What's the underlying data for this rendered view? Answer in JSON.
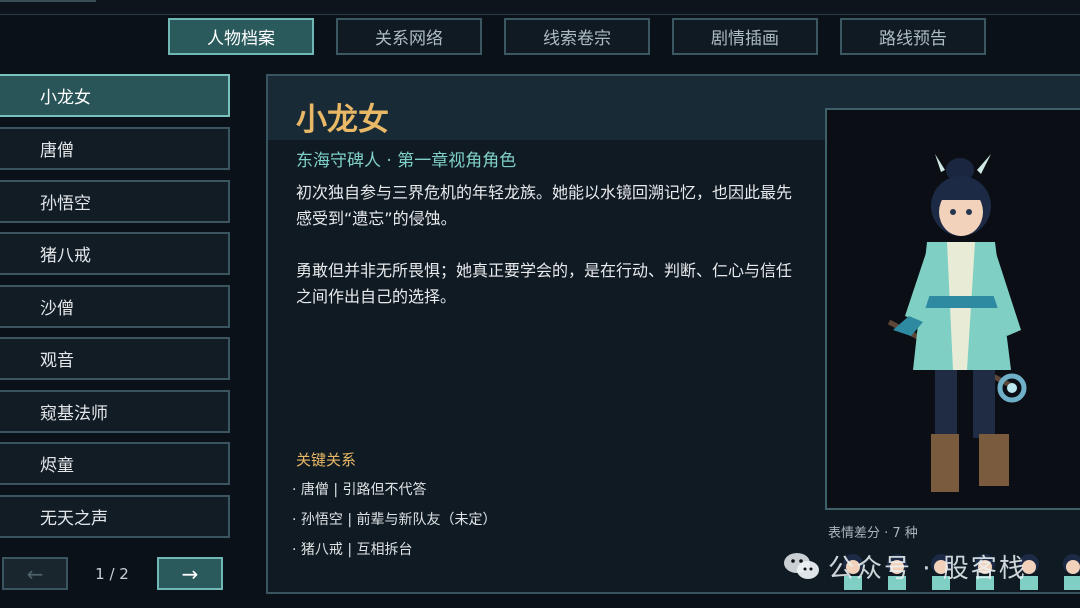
{
  "tabs": [
    {
      "label": "人物档案",
      "active": true
    },
    {
      "label": "关系网络",
      "active": false
    },
    {
      "label": "线索卷宗",
      "active": false
    },
    {
      "label": "剧情插画",
      "active": false
    },
    {
      "label": "路线预告",
      "active": false
    }
  ],
  "sidebar": {
    "items": [
      {
        "label": "小龙女",
        "active": true
      },
      {
        "label": "唐僧"
      },
      {
        "label": "孙悟空"
      },
      {
        "label": "猪八戒"
      },
      {
        "label": "沙僧"
      },
      {
        "label": "观音"
      },
      {
        "label": "窥基法师"
      },
      {
        "label": "烬童"
      },
      {
        "label": "无天之声"
      }
    ]
  },
  "pager": {
    "prev": "←",
    "next": "→",
    "text": "1 / 2"
  },
  "character": {
    "name": "小龙女",
    "subtitle": "东海守碑人 · 第一章视角角色",
    "desc1_line1": "初次独自参与三界危机的年轻龙族。她能以水镜回溯记忆，也因此最先",
    "desc1_line2": "感受到“遗忘”的侵蚀。",
    "desc2_line1": "勇敢但并非无所畏惧；她真正要学会的，是在行动、判断、仁心与信任",
    "desc2_line2": "之间作出自己的选择。",
    "relations_title": "关键关系",
    "relations": [
      "· 唐僧 | 引路但不代答",
      "· 孙悟空 | 前辈与新队友（未定）",
      "· 猪八戒 | 互相拆台"
    ],
    "expression_caption": "表情差分 · 7 种"
  },
  "watermark": {
    "text": "公众号 · 股客栈"
  },
  "colors": {
    "accent": "#e8b866",
    "teal": "#7fd0c8",
    "active_tab": "#2b5a5d",
    "background": "#0b1119"
  }
}
